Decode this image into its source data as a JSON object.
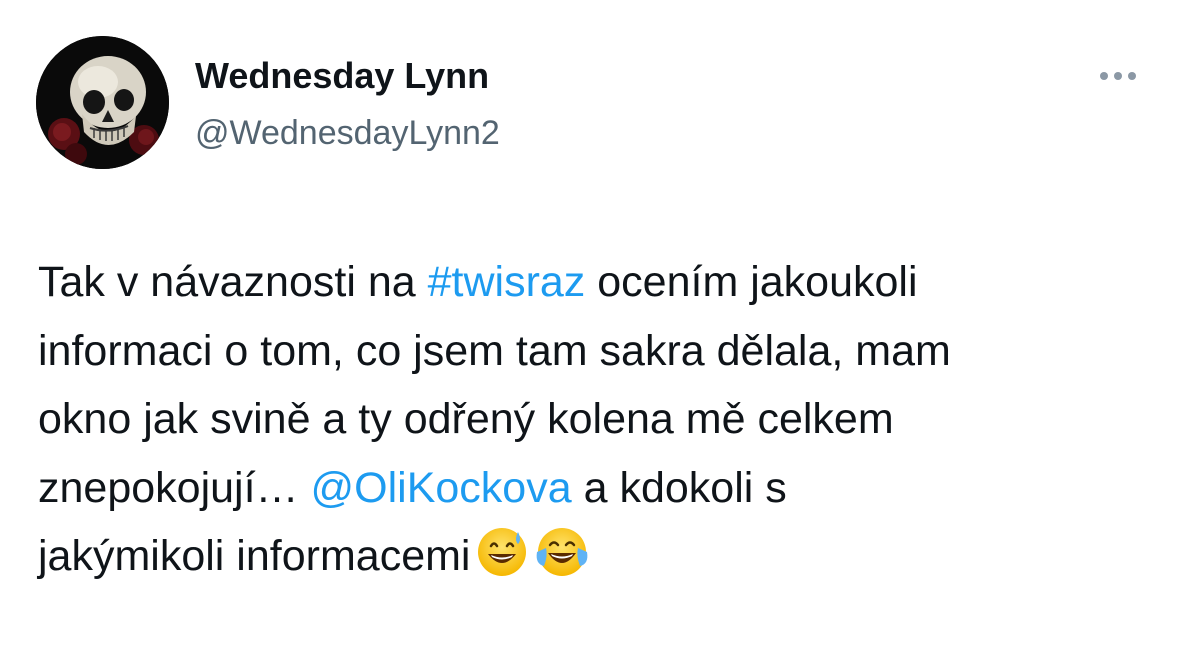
{
  "author": {
    "display_name": "Wednesday Lynn",
    "handle": "@WednesdayLynn2",
    "avatar_icon": "skull-with-roses-icon"
  },
  "menu": {
    "icon": "more-options-icon"
  },
  "colors": {
    "link": "#1d9bf0",
    "text": "#0f1419",
    "muted": "#536471"
  },
  "tweet": {
    "line1_a": "Tak v návaznosti na ",
    "hashtag": "#twisraz",
    "line1_b": " ocením jakoukoli",
    "line2": "informaci o tom, co jsem tam sakra dělala, mam",
    "line3": "okno jak svině a ty odřený kolena mě celkem",
    "line4_a": "znepokojují… ",
    "mention": "@OliKockova",
    "line4_b": " a kdokoli s",
    "line5": "jakýmikoli informacemi",
    "emojis": [
      "grinning-face-with-sweat-icon",
      "face-with-tears-of-joy-icon"
    ]
  }
}
